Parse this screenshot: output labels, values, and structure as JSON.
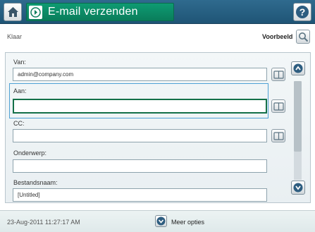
{
  "header": {
    "title": "E-mail verzenden",
    "home_icon": "home-icon",
    "app_icon": "email-send-icon",
    "help_icon": "help-icon"
  },
  "status": {
    "text": "Klaar",
    "preview_label": "Voorbeeld",
    "preview_icon": "magnifier-icon"
  },
  "fields": {
    "from": {
      "label": "Van:",
      "value": "admin@company.com"
    },
    "to": {
      "label": "Aan:",
      "value": ""
    },
    "cc": {
      "label": "CC:",
      "value": ""
    },
    "subject": {
      "label": "Onderwerp:",
      "value": ""
    },
    "filename": {
      "label": "Bestandsnaam:",
      "value": "[Untitled]"
    }
  },
  "footer": {
    "datetime": "23-Aug-2011 11:27:17 AM",
    "more_options": "Meer opties"
  },
  "colors": {
    "title_bar": "#2f6a8e",
    "title_group": "#0e9b72",
    "active_border": "#137048",
    "focus": "#4ea1d4"
  }
}
